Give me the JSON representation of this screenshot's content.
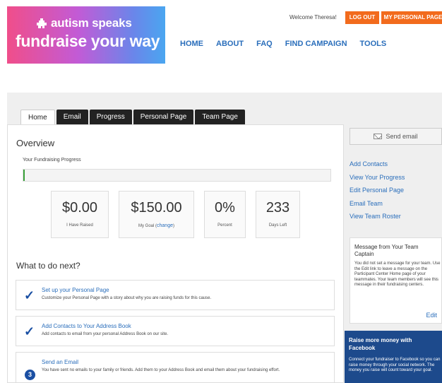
{
  "brand": {
    "name": "autism speaks",
    "tagline": "fundraise your way",
    "gradient_colors": [
      "#f04e8a",
      "#c25bd6",
      "#6a86ea",
      "#4aa6f0"
    ]
  },
  "header": {
    "welcome": "Welcome Theresa!",
    "logout_label": "LOG OUT",
    "my_page_label": "MY PERSONAL PAGE",
    "accent_color": "#f26b1d"
  },
  "nav": [
    "HOME",
    "ABOUT",
    "FAQ",
    "FIND CAMPAIGN",
    "TOOLS"
  ],
  "tabs": [
    "Home",
    "Email",
    "Progress",
    "Personal Page",
    "Team Page"
  ],
  "overview": {
    "heading": "Overview",
    "progress_label": "Your Fundraising Progress",
    "progress_fraction": 0
  },
  "stats": [
    {
      "value": "$0.00",
      "label": "I Have Raised"
    },
    {
      "value": "$150.00",
      "label": "My Goal (",
      "link": "change",
      "label_end": ")"
    },
    {
      "value": "0%",
      "label": "Percent"
    },
    {
      "value": "233",
      "label": "Days Left"
    }
  ],
  "next": {
    "heading": "What to do next?",
    "items": [
      {
        "marker": "✓",
        "title": "Set up your Personal Page",
        "desc": "Customize your Personal Page with a story about why you are raising funds for this cause."
      },
      {
        "marker": "✓",
        "title": "Add Contacts to Your Address Book",
        "desc": "Add contacts to email from your personal Address Book on our site."
      },
      {
        "marker": "3",
        "title": "Send an Email",
        "desc": "You have sent no emails to your family or friends. Add them to your Address Book and email them about your fundraising effort."
      }
    ]
  },
  "sidebar": {
    "send_email": "Send email",
    "links": [
      "Add Contacts",
      "View Your Progress",
      "Edit Personal Page",
      "Email Team",
      "View Team Roster"
    ],
    "message": {
      "title": "Message from Your Team Captain",
      "body": "You did not set a message for your team. Use the Edit link to leave a message on the Participant Center Home page of your teammates. Your team members will see this message in their fundraising centers.",
      "edit": "Edit"
    },
    "facebook": {
      "title": "Raise more money with Facebook",
      "body": "Connect your fundraiser to Facebook so you can raise money through your social network. The money you raise will count toward your goal."
    }
  }
}
